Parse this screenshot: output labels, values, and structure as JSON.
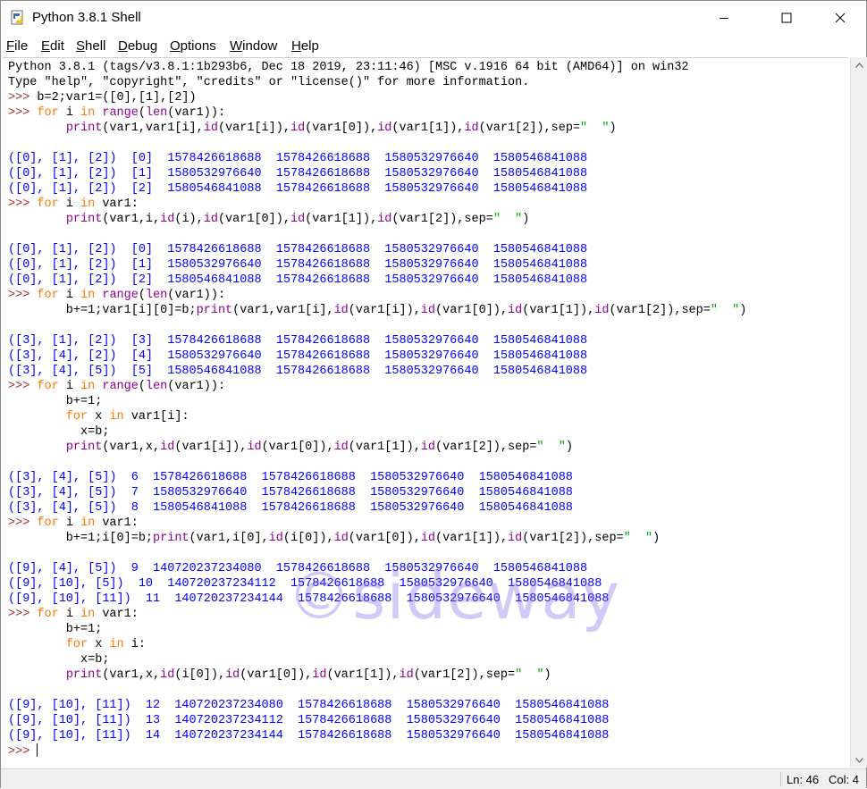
{
  "window": {
    "title": "Python 3.8.1 Shell",
    "icon": "python-idle-icon",
    "controls": [
      "minimize-icon",
      "maximize-icon",
      "close-icon"
    ]
  },
  "menu": [
    {
      "label": "File",
      "underline": "F",
      "rest": "ile"
    },
    {
      "label": "Edit",
      "underline": "E",
      "rest": "dit"
    },
    {
      "label": "Shell",
      "underline": "S",
      "rest": "hell"
    },
    {
      "label": "Debug",
      "underline": "D",
      "rest": "ebug"
    },
    {
      "label": "Options",
      "underline": "O",
      "rest": "ptions"
    },
    {
      "label": "Window",
      "underline": "W",
      "rest": "indow"
    },
    {
      "label": "Help",
      "underline": "H",
      "rest": "elp"
    }
  ],
  "console": {
    "lines": [
      [
        {
          "t": "Python 3.8.1 (tags/v3.8.1:1b293b6, Dec 18 2019, 23:11:46) [MSC v.1916 64 bit (AMD64)] on win32",
          "c": ""
        }
      ],
      [
        {
          "t": "Type \"help\", \"copyright\", \"credits\" or \"license()\" for more information.",
          "c": ""
        }
      ],
      [
        {
          "t": ">>> ",
          "c": "prompt"
        },
        {
          "t": "b=2;var1=([0],[1],[2])",
          "c": ""
        }
      ],
      [
        {
          "t": ">>> ",
          "c": "prompt"
        },
        {
          "t": "for",
          "c": "kw"
        },
        {
          "t": " i ",
          "c": ""
        },
        {
          "t": "in",
          "c": "kw"
        },
        {
          "t": " ",
          "c": ""
        },
        {
          "t": "range",
          "c": "bi"
        },
        {
          "t": "(",
          "c": ""
        },
        {
          "t": "len",
          "c": "bi"
        },
        {
          "t": "(var1)):",
          "c": ""
        }
      ],
      [
        {
          "t": "        ",
          "c": ""
        },
        {
          "t": "print",
          "c": "bi"
        },
        {
          "t": "(var1,var1[i],",
          "c": ""
        },
        {
          "t": "id",
          "c": "bi"
        },
        {
          "t": "(var1[i]),",
          "c": ""
        },
        {
          "t": "id",
          "c": "bi"
        },
        {
          "t": "(var1[0]),",
          "c": ""
        },
        {
          "t": "id",
          "c": "bi"
        },
        {
          "t": "(var1[1]),",
          "c": ""
        },
        {
          "t": "id",
          "c": "bi"
        },
        {
          "t": "(var1[2]),sep=",
          "c": ""
        },
        {
          "t": "\"  \"",
          "c": "str"
        },
        {
          "t": ")",
          "c": ""
        }
      ],
      [
        {
          "t": "",
          "c": ""
        }
      ],
      [
        {
          "t": "([0], [1], [2])  [0]  1578426618688  1578426618688  1580532976640  1580546841088",
          "c": "out"
        }
      ],
      [
        {
          "t": "([0], [1], [2])  [1]  1580532976640  1578426618688  1580532976640  1580546841088",
          "c": "out"
        }
      ],
      [
        {
          "t": "([0], [1], [2])  [2]  1580546841088  1578426618688  1580532976640  1580546841088",
          "c": "out"
        }
      ],
      [
        {
          "t": ">>> ",
          "c": "prompt"
        },
        {
          "t": "for",
          "c": "kw"
        },
        {
          "t": " i ",
          "c": ""
        },
        {
          "t": "in",
          "c": "kw"
        },
        {
          "t": " var1:",
          "c": ""
        }
      ],
      [
        {
          "t": "        ",
          "c": ""
        },
        {
          "t": "print",
          "c": "bi"
        },
        {
          "t": "(var1,i,",
          "c": ""
        },
        {
          "t": "id",
          "c": "bi"
        },
        {
          "t": "(i),",
          "c": ""
        },
        {
          "t": "id",
          "c": "bi"
        },
        {
          "t": "(var1[0]),",
          "c": ""
        },
        {
          "t": "id",
          "c": "bi"
        },
        {
          "t": "(var1[1]),",
          "c": ""
        },
        {
          "t": "id",
          "c": "bi"
        },
        {
          "t": "(var1[2]),sep=",
          "c": ""
        },
        {
          "t": "\"  \"",
          "c": "str"
        },
        {
          "t": ")",
          "c": ""
        }
      ],
      [
        {
          "t": "",
          "c": ""
        }
      ],
      [
        {
          "t": "([0], [1], [2])  [0]  1578426618688  1578426618688  1580532976640  1580546841088",
          "c": "out"
        }
      ],
      [
        {
          "t": "([0], [1], [2])  [1]  1580532976640  1578426618688  1580532976640  1580546841088",
          "c": "out"
        }
      ],
      [
        {
          "t": "([0], [1], [2])  [2]  1580546841088  1578426618688  1580532976640  1580546841088",
          "c": "out"
        }
      ],
      [
        {
          "t": ">>> ",
          "c": "prompt"
        },
        {
          "t": "for",
          "c": "kw"
        },
        {
          "t": " i ",
          "c": ""
        },
        {
          "t": "in",
          "c": "kw"
        },
        {
          "t": " ",
          "c": ""
        },
        {
          "t": "range",
          "c": "bi"
        },
        {
          "t": "(",
          "c": ""
        },
        {
          "t": "len",
          "c": "bi"
        },
        {
          "t": "(var1)):",
          "c": ""
        }
      ],
      [
        {
          "t": "        b+=1;var1[i][0]=b;",
          "c": ""
        },
        {
          "t": "print",
          "c": "bi"
        },
        {
          "t": "(var1,var1[i],",
          "c": ""
        },
        {
          "t": "id",
          "c": "bi"
        },
        {
          "t": "(var1[i]),",
          "c": ""
        },
        {
          "t": "id",
          "c": "bi"
        },
        {
          "t": "(var1[0]),",
          "c": ""
        },
        {
          "t": "id",
          "c": "bi"
        },
        {
          "t": "(var1[1]),",
          "c": ""
        },
        {
          "t": "id",
          "c": "bi"
        },
        {
          "t": "(var1[2]),sep=",
          "c": ""
        },
        {
          "t": "\"  \"",
          "c": "str"
        },
        {
          "t": ")",
          "c": ""
        }
      ],
      [
        {
          "t": "",
          "c": ""
        }
      ],
      [
        {
          "t": "([3], [1], [2])  [3]  1578426618688  1578426618688  1580532976640  1580546841088",
          "c": "out"
        }
      ],
      [
        {
          "t": "([3], [4], [2])  [4]  1580532976640  1578426618688  1580532976640  1580546841088",
          "c": "out"
        }
      ],
      [
        {
          "t": "([3], [4], [5])  [5]  1580546841088  1578426618688  1580532976640  1580546841088",
          "c": "out"
        }
      ],
      [
        {
          "t": ">>> ",
          "c": "prompt"
        },
        {
          "t": "for",
          "c": "kw"
        },
        {
          "t": " i ",
          "c": ""
        },
        {
          "t": "in",
          "c": "kw"
        },
        {
          "t": " ",
          "c": ""
        },
        {
          "t": "range",
          "c": "bi"
        },
        {
          "t": "(",
          "c": ""
        },
        {
          "t": "len",
          "c": "bi"
        },
        {
          "t": "(var1)):",
          "c": ""
        }
      ],
      [
        {
          "t": "        b+=1;",
          "c": ""
        }
      ],
      [
        {
          "t": "        ",
          "c": ""
        },
        {
          "t": "for",
          "c": "kw"
        },
        {
          "t": " x ",
          "c": ""
        },
        {
          "t": "in",
          "c": "kw"
        },
        {
          "t": " var1[i]:",
          "c": ""
        }
      ],
      [
        {
          "t": "          x=b;",
          "c": ""
        }
      ],
      [
        {
          "t": "        ",
          "c": ""
        },
        {
          "t": "print",
          "c": "bi"
        },
        {
          "t": "(var1,x,",
          "c": ""
        },
        {
          "t": "id",
          "c": "bi"
        },
        {
          "t": "(var1[i]),",
          "c": ""
        },
        {
          "t": "id",
          "c": "bi"
        },
        {
          "t": "(var1[0]),",
          "c": ""
        },
        {
          "t": "id",
          "c": "bi"
        },
        {
          "t": "(var1[1]),",
          "c": ""
        },
        {
          "t": "id",
          "c": "bi"
        },
        {
          "t": "(var1[2]),sep=",
          "c": ""
        },
        {
          "t": "\"  \"",
          "c": "str"
        },
        {
          "t": ")",
          "c": ""
        }
      ],
      [
        {
          "t": "",
          "c": ""
        }
      ],
      [
        {
          "t": "([3], [4], [5])  6  1578426618688  1578426618688  1580532976640  1580546841088",
          "c": "out"
        }
      ],
      [
        {
          "t": "([3], [4], [5])  7  1580532976640  1578426618688  1580532976640  1580546841088",
          "c": "out"
        }
      ],
      [
        {
          "t": "([3], [4], [5])  8  1580546841088  1578426618688  1580532976640  1580546841088",
          "c": "out"
        }
      ],
      [
        {
          "t": ">>> ",
          "c": "prompt"
        },
        {
          "t": "for",
          "c": "kw"
        },
        {
          "t": " i ",
          "c": ""
        },
        {
          "t": "in",
          "c": "kw"
        },
        {
          "t": " var1:",
          "c": ""
        }
      ],
      [
        {
          "t": "        b+=1;i[0]=b;",
          "c": ""
        },
        {
          "t": "print",
          "c": "bi"
        },
        {
          "t": "(var1,i[0],",
          "c": ""
        },
        {
          "t": "id",
          "c": "bi"
        },
        {
          "t": "(i[0]),",
          "c": ""
        },
        {
          "t": "id",
          "c": "bi"
        },
        {
          "t": "(var1[0]),",
          "c": ""
        },
        {
          "t": "id",
          "c": "bi"
        },
        {
          "t": "(var1[1]),",
          "c": ""
        },
        {
          "t": "id",
          "c": "bi"
        },
        {
          "t": "(var1[2]),sep=",
          "c": ""
        },
        {
          "t": "\"  \"",
          "c": "str"
        },
        {
          "t": ")",
          "c": ""
        }
      ],
      [
        {
          "t": "",
          "c": ""
        }
      ],
      [
        {
          "t": "([9], [4], [5])  9  140720237234080  1578426618688  1580532976640  1580546841088",
          "c": "out"
        }
      ],
      [
        {
          "t": "([9], [10], [5])  10  140720237234112  1578426618688  1580532976640  1580546841088",
          "c": "out"
        }
      ],
      [
        {
          "t": "([9], [10], [11])  11  140720237234144  1578426618688  1580532976640  1580546841088",
          "c": "out"
        }
      ],
      [
        {
          "t": ">>> ",
          "c": "prompt"
        },
        {
          "t": "for",
          "c": "kw"
        },
        {
          "t": " i ",
          "c": ""
        },
        {
          "t": "in",
          "c": "kw"
        },
        {
          "t": " var1:",
          "c": ""
        }
      ],
      [
        {
          "t": "        b+=1;",
          "c": ""
        }
      ],
      [
        {
          "t": "        ",
          "c": ""
        },
        {
          "t": "for",
          "c": "kw"
        },
        {
          "t": " x ",
          "c": ""
        },
        {
          "t": "in",
          "c": "kw"
        },
        {
          "t": " i:",
          "c": ""
        }
      ],
      [
        {
          "t": "          x=b;",
          "c": ""
        }
      ],
      [
        {
          "t": "        ",
          "c": ""
        },
        {
          "t": "print",
          "c": "bi"
        },
        {
          "t": "(var1,x,",
          "c": ""
        },
        {
          "t": "id",
          "c": "bi"
        },
        {
          "t": "(i[0]),",
          "c": ""
        },
        {
          "t": "id",
          "c": "bi"
        },
        {
          "t": "(var1[0]),",
          "c": ""
        },
        {
          "t": "id",
          "c": "bi"
        },
        {
          "t": "(var1[1]),",
          "c": ""
        },
        {
          "t": "id",
          "c": "bi"
        },
        {
          "t": "(var1[2]),sep=",
          "c": ""
        },
        {
          "t": "\"  \"",
          "c": "str"
        },
        {
          "t": ")",
          "c": ""
        }
      ],
      [
        {
          "t": "",
          "c": ""
        }
      ],
      [
        {
          "t": "([9], [10], [11])  12  140720237234080  1578426618688  1580532976640  1580546841088",
          "c": "out"
        }
      ],
      [
        {
          "t": "([9], [10], [11])  13  140720237234112  1578426618688  1580532976640  1580546841088",
          "c": "out"
        }
      ],
      [
        {
          "t": "([9], [10], [11])  14  140720237234144  1578426618688  1580532976640  1580546841088",
          "c": "out"
        }
      ],
      [
        {
          "t": ">>> ",
          "c": "prompt"
        }
      ]
    ]
  },
  "watermark": "©sideway",
  "status": {
    "line": "Ln: 46",
    "col": "Col: 4"
  },
  "colors": {
    "output": "#0000ff",
    "keyword": "#ff7700",
    "builtin": "#900090",
    "string": "#00aa00",
    "prompt": "#a52a2a"
  }
}
